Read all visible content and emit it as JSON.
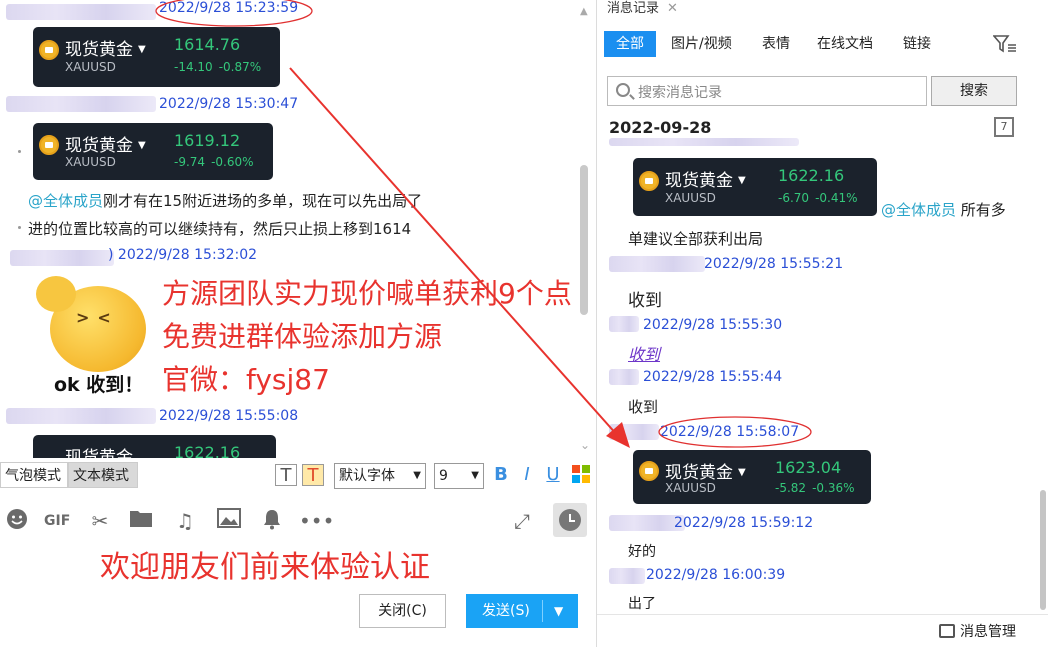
{
  "left": {
    "messages": [
      {
        "time": "2022/9/28 15:23:59",
        "card": {
          "name": "现货黄金",
          "symbol": "XAUUSD",
          "price": "1614.76",
          "change": "-14.10",
          "change_pct": "-0.87%"
        }
      },
      {
        "time": "2022/9/28 15:30:47",
        "card": {
          "name": "现货黄金",
          "symbol": "XAUUSD",
          "price": "1619.12",
          "change": "-9.74",
          "change_pct": "-0.60%"
        },
        "mention": "@全体成员",
        "text_line1": "刚才有在15附近进场的多单，现在可以先出局了",
        "text_line2": "进的位置比较高的可以继续持有，然后只止损上移到1614"
      },
      {
        "time": ") 2022/9/28 15:32:02",
        "sticker_caption": "ok 收到！"
      },
      {
        "time": "2022/9/28 15:55:08",
        "card": {
          "name": "现货黄金",
          "price": "1622.16"
        }
      }
    ],
    "promo": [
      "方源团队实力现价喊单获利9个点",
      "免费进群体验添加方源",
      "官微：fysj87"
    ],
    "toolbar": {
      "bubble_mode": "气泡模式",
      "text_mode": "文本模式",
      "font_name": "默认字体",
      "font_size": "9"
    },
    "promo_bottom": "欢迎朋友们前来体验认证",
    "close_label": "关闭(C)",
    "send_label": "发送(S)"
  },
  "right": {
    "tab_title": "消息记录",
    "filters": [
      "全部",
      "图片/视频",
      "表情",
      "在线文档",
      "链接"
    ],
    "search_placeholder": "搜索消息记录",
    "search_button": "搜索",
    "date": "2022-09-28",
    "cal_day": "7",
    "messages": [
      {
        "card": {
          "name": "现货黄金",
          "symbol": "XAUUSD",
          "price": "1622.16",
          "change": "-6.70",
          "change_pct": "-0.41%"
        },
        "mention": "@全体成员",
        "text_a": "所有多",
        "text_b": "单建议全部获利出局"
      },
      {
        "time": "2022/9/28 15:55:21",
        "text": "收到"
      },
      {
        "time": "2022/9/28 15:55:30",
        "text": "收到"
      },
      {
        "time": "2022/9/28 15:55:44",
        "text": "收到"
      },
      {
        "time": "2022/9/28 15:58:07",
        "card": {
          "name": "现货黄金",
          "symbol": "XAUUSD",
          "price": "1623.04",
          "change": "-5.82",
          "change_pct": "-0.36%"
        }
      },
      {
        "time": "2022/9/28 15:59:12",
        "text": "好的"
      },
      {
        "time": "2022/9/28 16:00:39",
        "text": "出了"
      }
    ],
    "manage_label": "消息管理"
  },
  "colors": {
    "accent": "#1b8ff0",
    "promo_red": "#e8332e",
    "timestamp_blue": "#2b4fd6",
    "card_bg": "#1b222c",
    "change_green": "#34c77b"
  }
}
